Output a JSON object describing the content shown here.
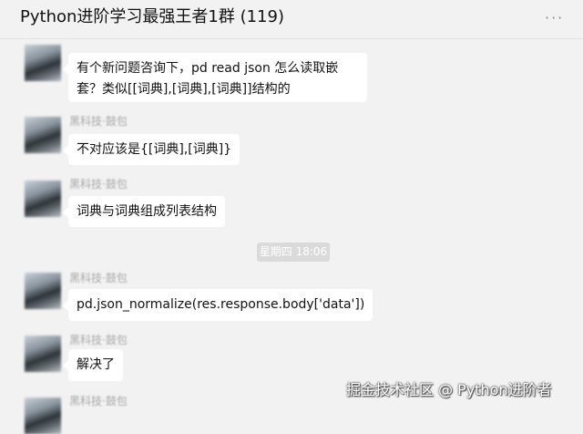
{
  "header": {
    "title": "Python进阶学习最强王者1群 (119)",
    "more_icon": "more-horizontal-icon"
  },
  "messages": [
    {
      "sender": "",
      "text": "有个新问题咨询下，pd   read json     怎么读取嵌套？类似[[词典],[词典],[词典]]结构的"
    },
    {
      "sender": "黑科技·鼓包",
      "text": "不对应该是{[词典],[词典]}"
    },
    {
      "sender": "黑科技·鼓包",
      "text": "词典与词典组成列表结构"
    },
    {
      "sender": "黑科技·鼓包",
      "text": "pd.json_normalize(res.response.body['data'])"
    },
    {
      "sender": "黑科技·鼓包",
      "text": "解决了"
    },
    {
      "sender": "黑科技·鼓包"
    }
  ],
  "time_separator": "星期四 18:06",
  "watermark": "掘金技术社区 @ Python进阶者",
  "colors": {
    "background": "#f2f2f2",
    "bubble": "#ffffff",
    "sender": "#a8a8a8"
  }
}
